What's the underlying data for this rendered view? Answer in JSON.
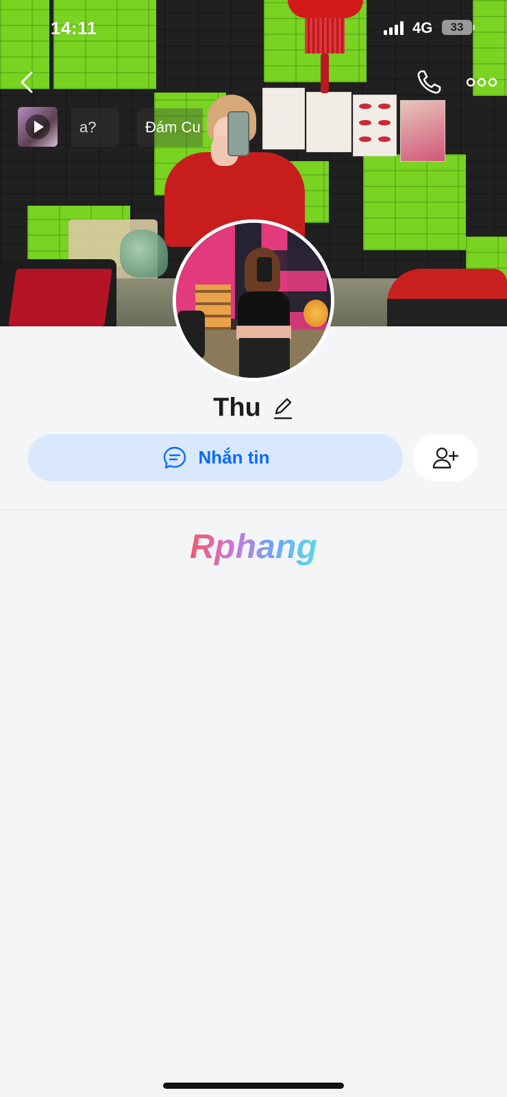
{
  "status_bar": {
    "time": "14:11",
    "network": "4G",
    "battery": "33"
  },
  "nav": {
    "back_icon": "chevron-left-icon",
    "call_icon": "phone-icon",
    "more_icon": "more-dots-icon"
  },
  "stories": {
    "thumb_icon": "play-icon",
    "items": [
      {
        "label": "a?"
      },
      {
        "label": "Đám Cu"
      }
    ]
  },
  "profile": {
    "name": "Thu",
    "edit_icon": "pencil-icon"
  },
  "actions": {
    "message_label": "Nhắn tin",
    "message_icon": "chat-bubble-icon",
    "add_friend_icon": "add-user-icon"
  },
  "watermark": {
    "text": "Rphang"
  },
  "colors": {
    "accent": "#0a68ff",
    "message_button_bg": "#d9e8fd",
    "page_bg": "#f4f5f7"
  }
}
